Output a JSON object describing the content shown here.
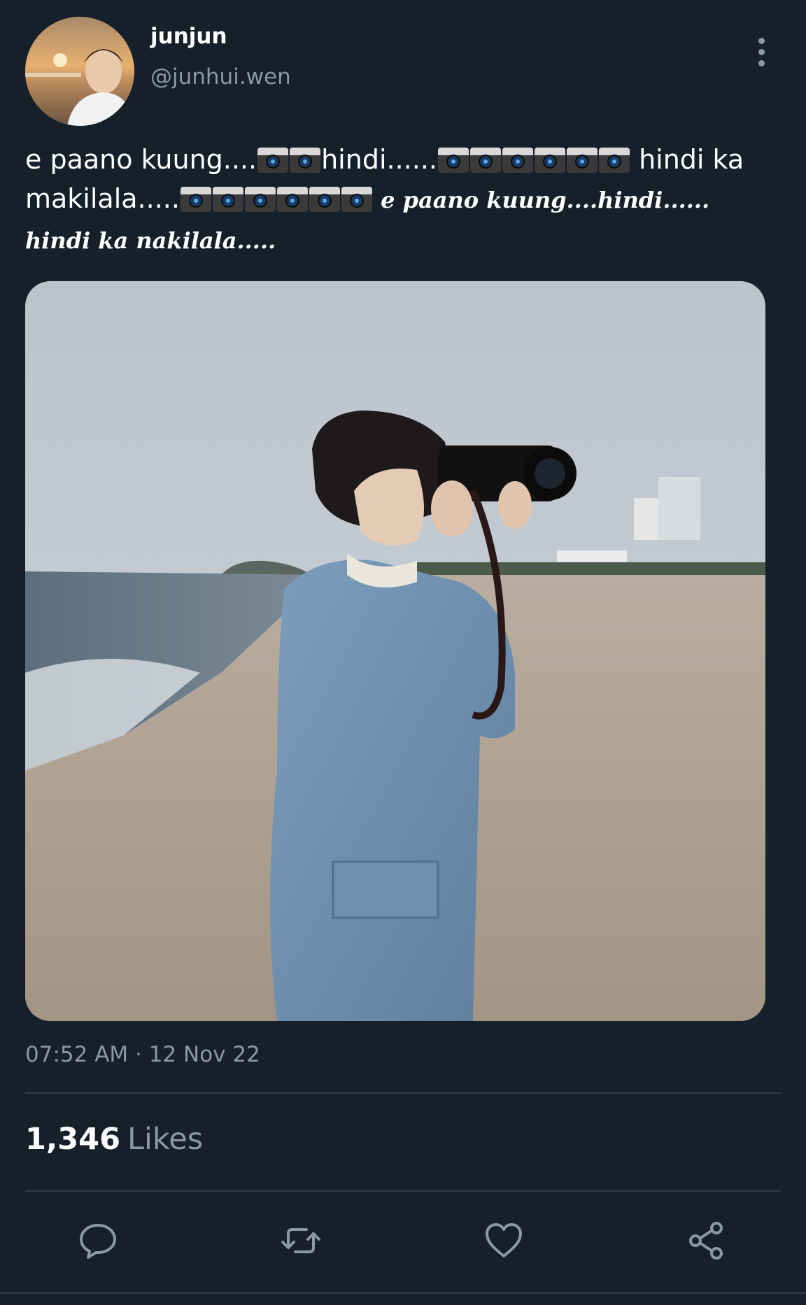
{
  "user": {
    "display_name": "junjun",
    "handle": "@junhui.wen"
  },
  "tweet": {
    "text_part1": "e paano kuung....",
    "text_part2": "hindi......",
    "text_part3": " hindi ka makilala.....",
    "text_script": " e paano kuung....hindi...... hindi ka nakilala....."
  },
  "meta": {
    "timestamp": "07:52 AM · 12 Nov 22"
  },
  "stats": {
    "likes_count": "1,346",
    "likes_label": "Likes"
  },
  "icons": {
    "reply": "reply-icon",
    "retweet": "retweet-icon",
    "like": "heart-icon",
    "share": "share-icon",
    "more": "more-vertical-icon",
    "camera_emoji": "camera-emoji-icon"
  },
  "colors": {
    "background": "#15202b",
    "secondary_text": "#8b98a5",
    "divider": "#2f3b46"
  }
}
